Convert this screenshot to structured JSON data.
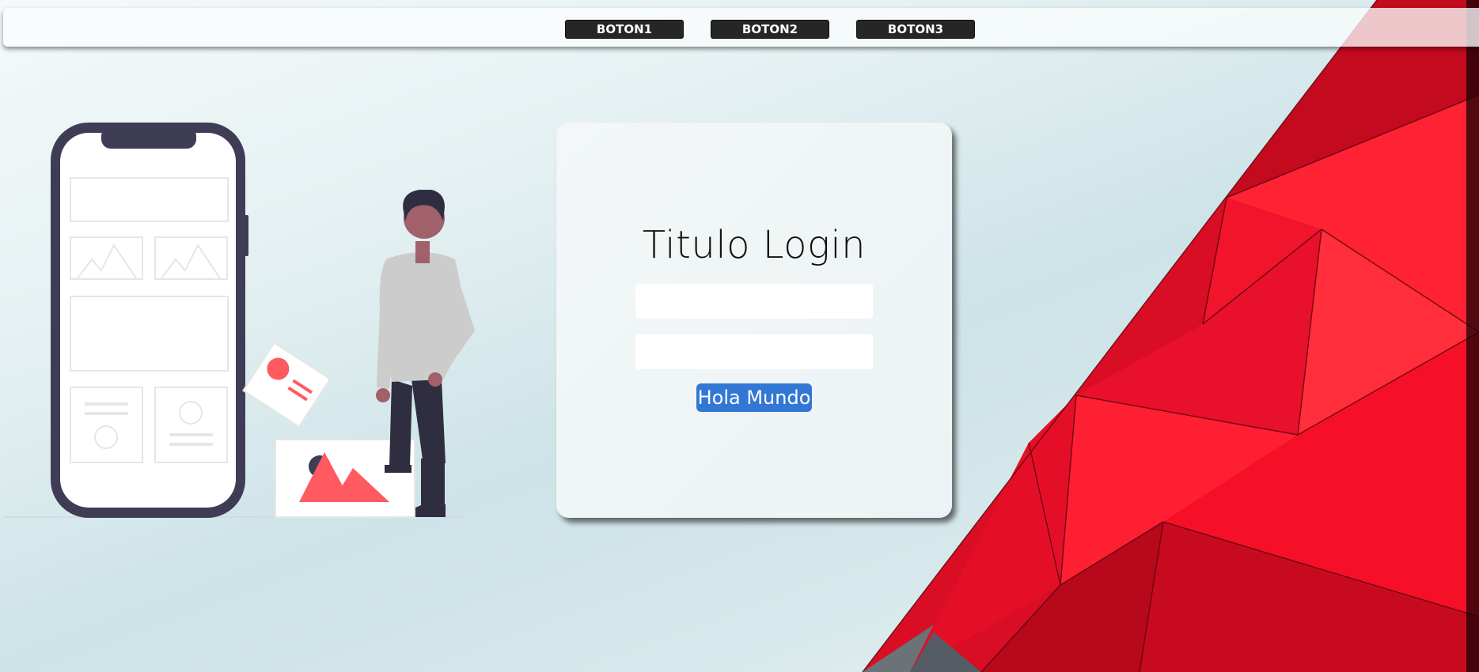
{
  "nav": {
    "buttons": [
      {
        "label": "BOTON1"
      },
      {
        "label": "BOTON2"
      },
      {
        "label": "BOTON3"
      }
    ]
  },
  "login": {
    "title": "Titulo Login",
    "username": {
      "value": "",
      "placeholder": ""
    },
    "password": {
      "value": "",
      "placeholder": ""
    },
    "submit_label": "Hola Mundo"
  },
  "colors": {
    "accent": "#3277d4",
    "nav_button": "#262626",
    "background_art": "#e3102a",
    "illustration_accent": "#ff5a5f",
    "illustration_dark": "#3f3d56"
  },
  "icons": [
    "phone-illustration-icon",
    "person-illustration-icon",
    "image-card-icon"
  ]
}
